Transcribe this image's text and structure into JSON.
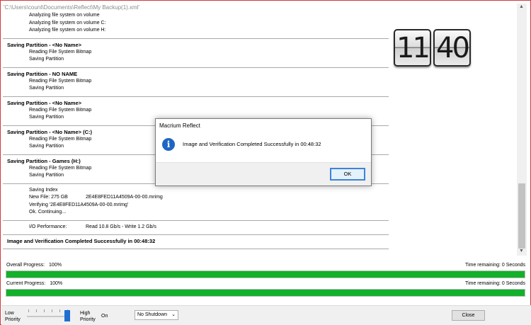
{
  "window": {
    "path": "'C:\\Users\\count\\Documents\\Reflect\\My Backup(1).xml'"
  },
  "log": {
    "top_lines": [
      "Analyzing file system on volume",
      "Analyzing file system on volume C:",
      "Analyzing file system on volume H:"
    ],
    "sections": [
      {
        "head": "Saving Partition - <No Name>",
        "lines": [
          "Reading File System Bitmap",
          "Saving Partition"
        ]
      },
      {
        "head": "Saving Partition - NO NAME",
        "lines": [
          "Reading File System Bitmap",
          "Saving Partition"
        ]
      },
      {
        "head": "Saving Partition - <No Name>",
        "lines": [
          "Reading File System Bitmap",
          "Saving Partition"
        ]
      },
      {
        "head": "Saving Partition - <No Name> (C:)",
        "lines": [
          "Reading File System Bitmap",
          "Saving Partition"
        ]
      },
      {
        "head": "Saving Partition - Games (H:)",
        "lines": [
          "Reading File System Bitmap",
          "Saving Partition"
        ]
      }
    ],
    "index": {
      "saving_index": "Saving Index",
      "new_file_label": "New File: 275 GB",
      "new_file_name": "2E4E8FED11A4509A-00-00.mrimg",
      "verifying": "Verifying '2E4E8FED11A4509A-00-00.mrimg'",
      "continuing": "Ok. Continuing..."
    },
    "io": {
      "label": "I/O Performance:",
      "value": "Read 10.8 Gb/s - Write 1.2 Gb/s"
    },
    "final": "Image and Verification Completed Successfully in 00:48:32"
  },
  "clock": {
    "hours": "11",
    "minutes": "40"
  },
  "progress": {
    "overall": {
      "label": "Overall Progress:",
      "value": "100%",
      "time": "Time remaining: 0 Seconds",
      "fraction": 1.0
    },
    "current": {
      "label": "Current Progress:",
      "value": "100%",
      "time": "Time remaining: 0 Seconds",
      "fraction": 1.0
    },
    "fill_color": "#12b12a"
  },
  "bottom": {
    "low_priority": "Low\nPriority",
    "high_priority": "High\nPriority",
    "on_label": "On",
    "shutdown_selected": "No Shutdown",
    "close_label": "Close"
  },
  "dialog": {
    "title": "Macrium Reflect",
    "icon": "info-icon",
    "message": "Image and Verification Completed Successfully in 00:48:32",
    "ok_label": "OK"
  }
}
